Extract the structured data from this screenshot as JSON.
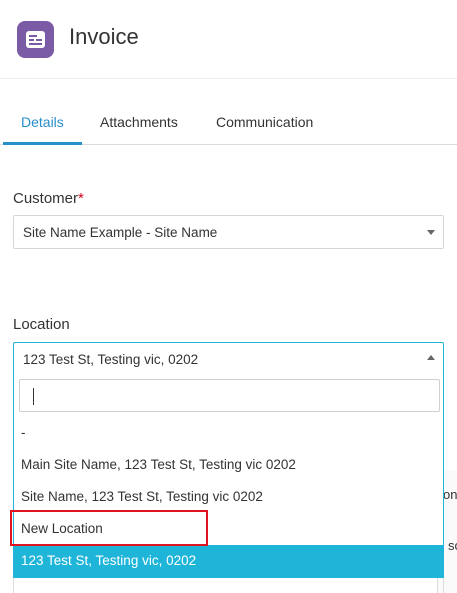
{
  "header": {
    "title": "Invoice",
    "icon": "invoice-icon",
    "icon_color": "#7b5aa6"
  },
  "tabs": [
    {
      "label": "Details",
      "active": true
    },
    {
      "label": "Attachments",
      "active": false
    },
    {
      "label": "Communication",
      "active": false
    }
  ],
  "customer": {
    "label": "Customer",
    "required_mark": "*",
    "value": "Site Name Example - Site Name"
  },
  "location": {
    "label": "Location",
    "value": "123 Test St, Testing vic, 0202",
    "search_value": "",
    "options": [
      "-",
      "Main Site Name, 123 Test St, Testing vic 0202",
      "Site Name, 123 Test St, Testing vic 0202",
      "New Location",
      "123 Test St, Testing vic, 0202"
    ],
    "selected_option": "123 Test St, Testing vic, 0202",
    "highlighted_option": "New Location"
  },
  "background": {
    "partial_text_1": "on",
    "partial_text_2": "sc"
  },
  "colors": {
    "accent": "#2a8fc9",
    "selected": "#1fb5d9",
    "highlight_box": "#e0141e"
  }
}
